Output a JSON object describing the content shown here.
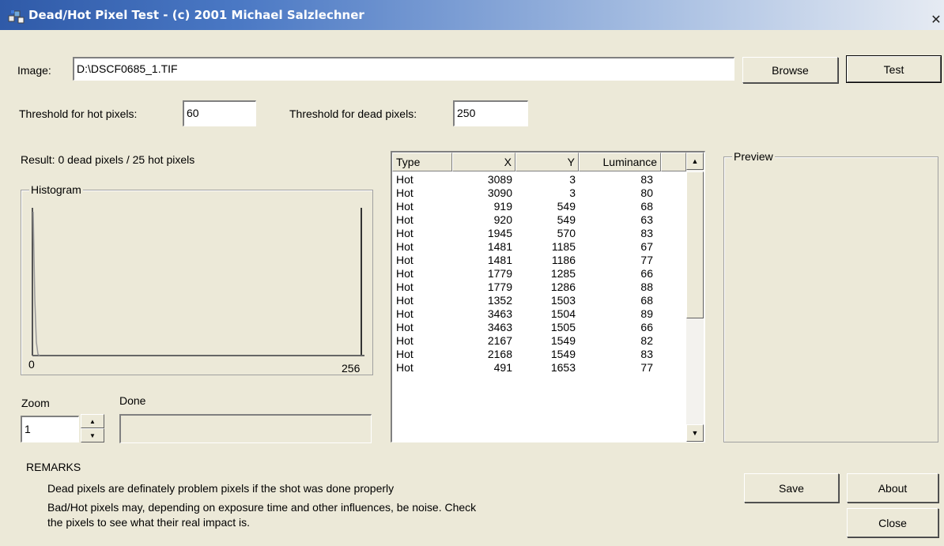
{
  "window": {
    "title": "Dead/Hot Pixel Test - (c) 2001 Michael Salzlechner"
  },
  "image": {
    "label": "Image:",
    "value": "D:\\DSCF0685_1.TIF",
    "browse_label": "Browse",
    "test_label": "Test"
  },
  "thresholds": {
    "hot_label": "Threshold for hot pixels:",
    "hot_value": "60",
    "dead_label": "Threshold for dead pixels:",
    "dead_value": "250"
  },
  "result": {
    "text": "Result:  0 dead pixels / 25 hot pixels"
  },
  "histogram": {
    "title": "Histogram",
    "min_label": "0",
    "max_label": "256"
  },
  "zoom": {
    "label": "Zoom",
    "value": "1"
  },
  "progress": {
    "label": "Done",
    "value": 0
  },
  "table": {
    "columns": [
      "Type",
      "X",
      "Y",
      "Luminance"
    ],
    "rows": [
      [
        "Hot",
        "3089",
        "3",
        "83"
      ],
      [
        "Hot",
        "3090",
        "3",
        "80"
      ],
      [
        "Hot",
        "919",
        "549",
        "68"
      ],
      [
        "Hot",
        "920",
        "549",
        "63"
      ],
      [
        "Hot",
        "1945",
        "570",
        "83"
      ],
      [
        "Hot",
        "1481",
        "1185",
        "67"
      ],
      [
        "Hot",
        "1481",
        "1186",
        "77"
      ],
      [
        "Hot",
        "1779",
        "1285",
        "66"
      ],
      [
        "Hot",
        "1779",
        "1286",
        "88"
      ],
      [
        "Hot",
        "1352",
        "1503",
        "68"
      ],
      [
        "Hot",
        "3463",
        "1504",
        "89"
      ],
      [
        "Hot",
        "3463",
        "1505",
        "66"
      ],
      [
        "Hot",
        "2167",
        "1549",
        "82"
      ],
      [
        "Hot",
        "2168",
        "1549",
        "83"
      ],
      [
        "Hot",
        "491",
        "1653",
        "77"
      ]
    ]
  },
  "preview": {
    "title": "Preview"
  },
  "remarks": {
    "title": "REMARKS",
    "line1": "Dead pixels are definately problem pixels if the shot was done properly",
    "line2": "Bad/Hot pixels may, depending on exposure time and other influences, be noise. Check",
    "line3": "the pixels to see what their real impact is."
  },
  "buttons": {
    "save": "Save",
    "about": "About",
    "close": "Close"
  },
  "colors": {
    "titlebar_start": "#2f5aa8",
    "face": "#ece9d8"
  },
  "icons": {
    "app": "app-icon",
    "close": "close-icon"
  }
}
